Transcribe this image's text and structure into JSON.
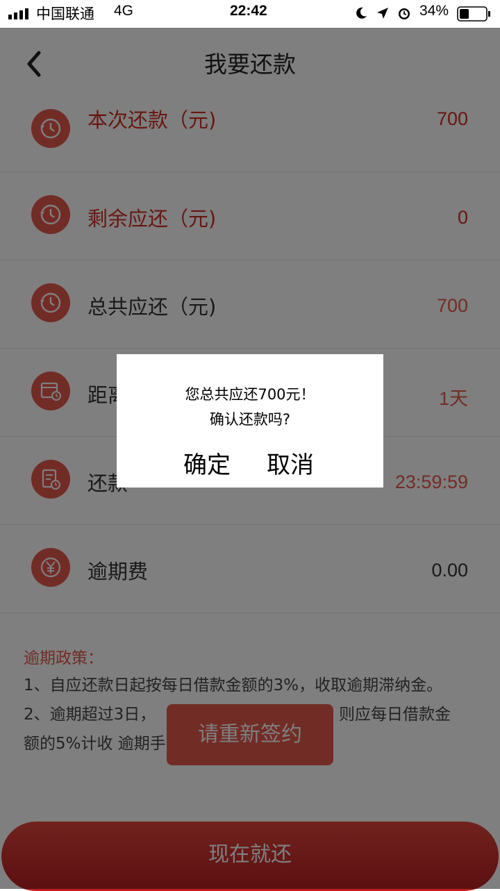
{
  "status_bar": {
    "carrier": "中国联通",
    "network": "4G",
    "time": "22:42",
    "battery": "34%"
  },
  "nav": {
    "title": "我要还款",
    "back_icon": "chevron-left-icon"
  },
  "rows": [
    {
      "label": "本次还款（元)",
      "value": "700",
      "icon": "history-icon"
    },
    {
      "label": "剩余应还（元)",
      "value": "0",
      "icon": "history-icon"
    },
    {
      "label": "总共应还（元)",
      "value": "700",
      "icon": "history-icon"
    },
    {
      "label": "距离",
      "value": "1天",
      "icon": "calendar-clock-icon"
    },
    {
      "label": "还款",
      "value": "23:59:59",
      "icon": "document-clock-icon"
    },
    {
      "label": "逾期费",
      "value": "0.00",
      "icon": "yen-icon"
    }
  ],
  "policy": {
    "title": "逾期政策：",
    "line1": "1、自应还款日起按每日借款金额的3%，收取逾期滞纳金。",
    "line2a": "2、逾期超过3日，",
    "line2b": "则应每日借款金",
    "line3": "额的5%计收 逾期手"
  },
  "resign_button": "请重新签约",
  "pay_button": "现在就还",
  "dialog": {
    "message_line1": "您总共应还700元！",
    "message_line2": "确认还款吗?",
    "confirm_label": "确定",
    "cancel_label": "取消"
  },
  "colors": {
    "accent_red": "#cf2f24",
    "icon_red": "#e5594d",
    "overlay": "rgba(0,0,0,0.5)"
  }
}
